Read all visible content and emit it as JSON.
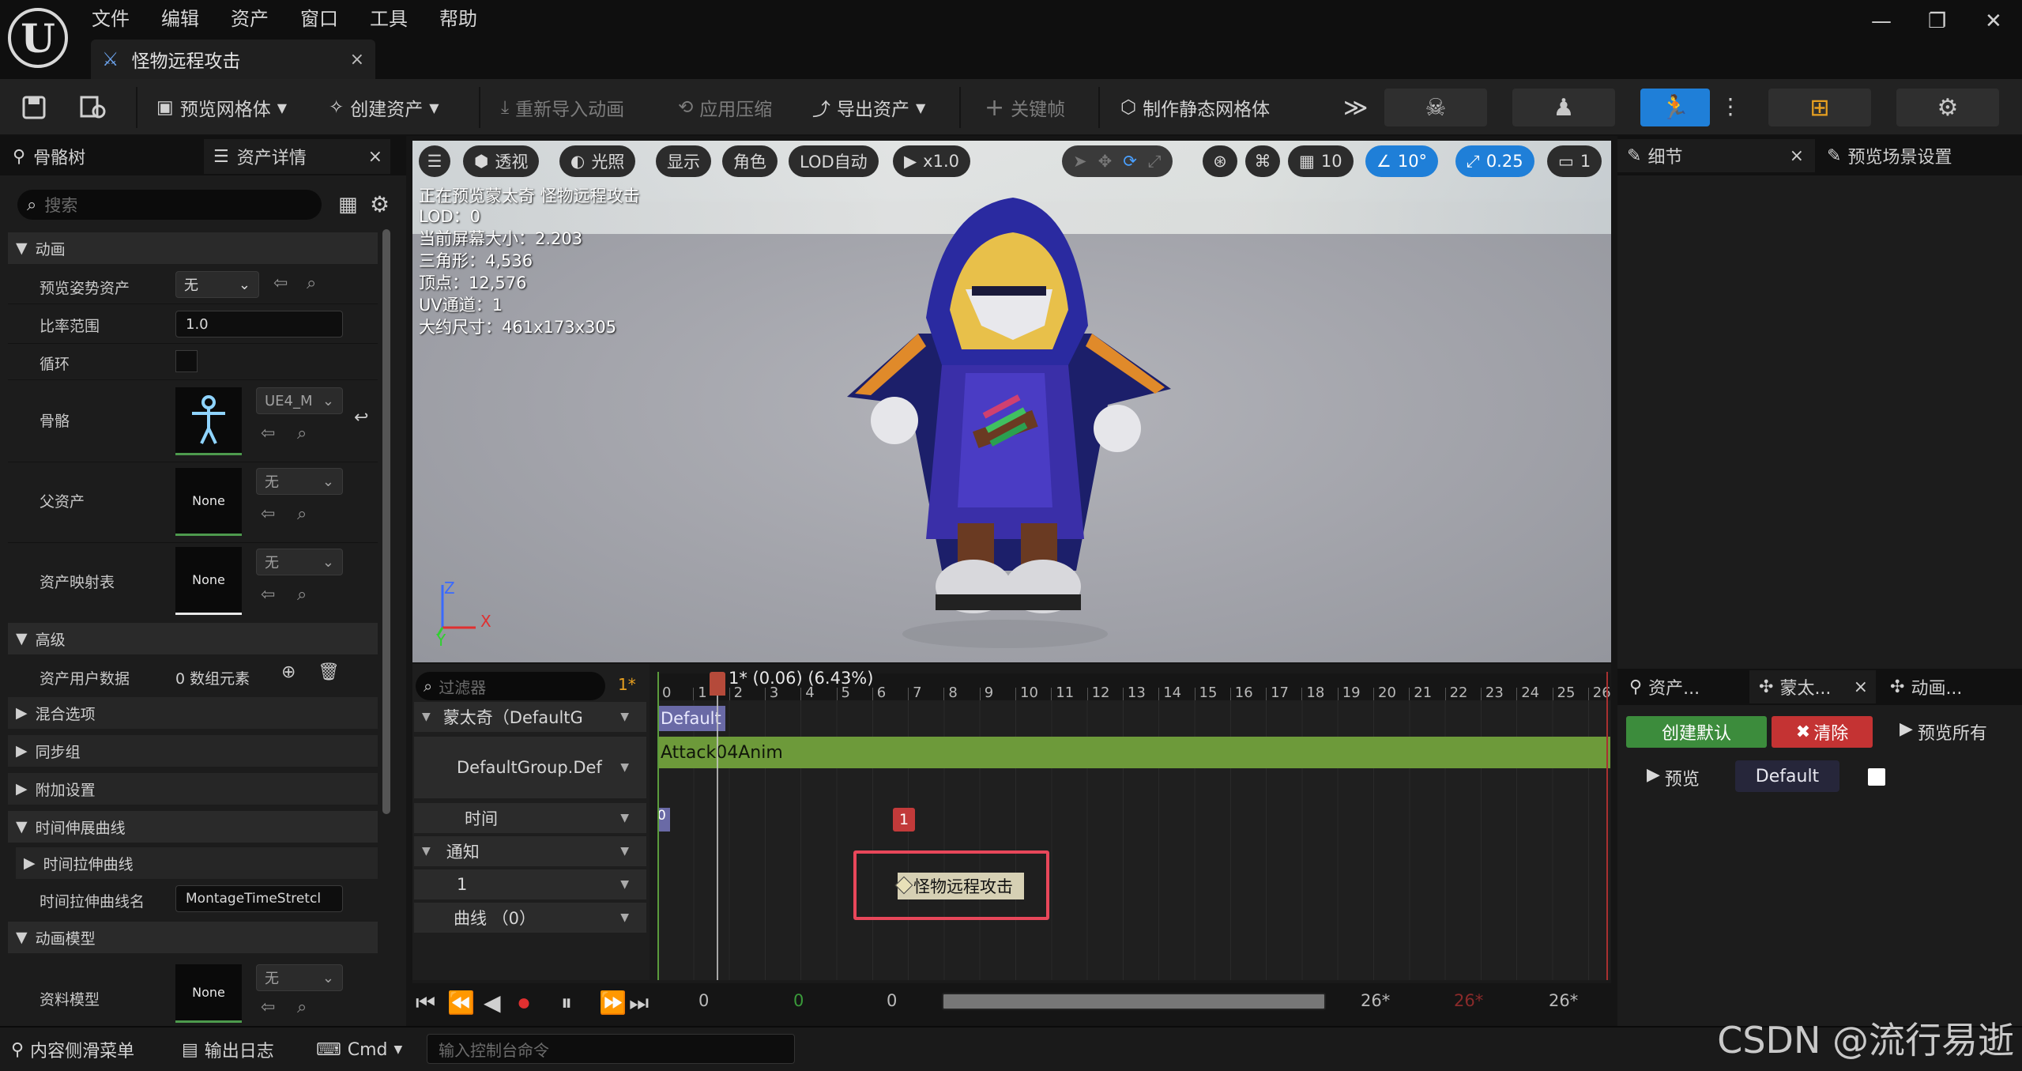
{
  "menu": [
    "文件",
    "编辑",
    "资产",
    "窗口",
    "工具",
    "帮助"
  ],
  "tab": {
    "title": "怪物远程攻击",
    "close": "×"
  },
  "toolbar": {
    "preview_mesh": "预览网格体",
    "create_asset": "创建资产",
    "reimport_anim": "重新导入动画",
    "apply_compress": "应用压缩",
    "export_asset": "导出资产",
    "keyframe": "关键帧",
    "make_static_mesh": "制作静态网格体",
    "more": "≫"
  },
  "left_panel": {
    "tabs": [
      "骨骼树",
      "资产详情"
    ],
    "search_placeholder": "搜索",
    "sections": {
      "animation": "动画",
      "advanced": "高级",
      "blend": "混合选项",
      "sync": "同步组",
      "attach": "附加设置",
      "time_stretch_curve_sec": "时间伸展曲线",
      "time_stretch_curve_sub": "时间拉伸曲线",
      "anim_model": "动画模型"
    },
    "rows": {
      "preview_pose": "预览姿势资产",
      "preview_pose_value": "无",
      "rate_scale": "比率范围",
      "rate_scale_value": "1.0",
      "loop": "循环",
      "skeleton": "骨骼",
      "skeleton_value": "UE4_M",
      "parent_asset": "父资产",
      "parent_asset_value": "无",
      "none_label": "None",
      "asset_map": "资产映射表",
      "asset_map_value": "无",
      "user_data": "资产用户数据",
      "user_data_value": "0 数组元素",
      "stretch_curve_name": "时间拉伸曲线名",
      "stretch_curve_name_value": "MontageTimeStretcl",
      "data_model": "资料模型",
      "data_model_value": "无"
    }
  },
  "viewport": {
    "buttons": [
      "透视",
      "光照",
      "显示",
      "角色",
      "LOD自动",
      "x1.0"
    ],
    "grid": "10",
    "angle": "10°",
    "scale": "0.25",
    "camera": "1",
    "stats": [
      "正在预览蒙太奇 怪物远程攻击",
      "LOD：0",
      "当前屏幕大小：2.203",
      "三角形：4,536",
      "顶点：12,576",
      "UV通道：1",
      "大约尺寸：461x173x305"
    ],
    "axes": {
      "z": "Z",
      "y": "Y",
      "x": "X"
    }
  },
  "timeline": {
    "filter_placeholder": "过滤器",
    "frame_badge": "1*",
    "frame_readout": "1* (0.06) (6.43%)",
    "tracks": {
      "montage": "蒙太奇（DefaultG",
      "group": "DefaultGroup.Def",
      "time": "时间",
      "notify": "通知",
      "notify_track": "1",
      "curves": "曲线 （0）"
    },
    "ticks": [
      "0",
      "1",
      "2",
      "3",
      "4",
      "5",
      "6",
      "7",
      "8",
      "9",
      "10",
      "11",
      "12",
      "13",
      "14",
      "15",
      "16",
      "17",
      "18",
      "19",
      "20",
      "21",
      "22",
      "23",
      "24",
      "25",
      "26"
    ],
    "default_chip": "Default",
    "anim_segment": "Attack04Anim",
    "time_marker_left": "0",
    "time_marker": "1",
    "notify_name": "怪物远程攻击",
    "playbar": {
      "start": "0",
      "cur_green": "0",
      "cur": "0",
      "end1": "26*",
      "end2": "26*",
      "end3": "26*"
    }
  },
  "right_panel": {
    "tabs": [
      "细节",
      "预览场景设置"
    ],
    "tabs2": [
      "资产...",
      "蒙太...",
      "动画..."
    ],
    "create_default": "创建默认",
    "clear": "清除",
    "preview_all": "预览所有",
    "preview": "预览",
    "section_name": "Default"
  },
  "bottom": {
    "content_drawer": "内容侧滑菜单",
    "output_log": "输出日志",
    "cmd": "Cmd",
    "cmd_placeholder": "输入控制台命令"
  },
  "watermark": "CSDN @流行易逝"
}
